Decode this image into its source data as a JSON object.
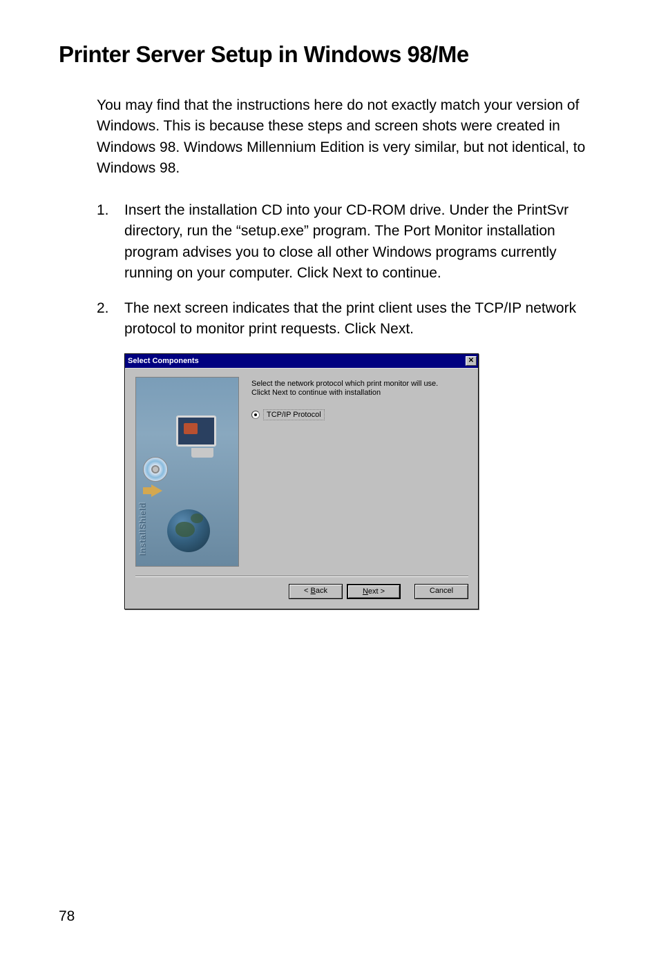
{
  "heading": "Printer Server Setup in Windows 98/Me",
  "intro": "You may find that the instructions here do not exactly match your version of Windows. This is because these steps and screen shots were created in Windows 98. Windows Millennium Edition is very similar, but not identical, to Windows 98.",
  "steps": [
    {
      "number": "1.",
      "text": "Insert the installation CD into your CD-ROM drive. Under the PrintSvr directory, run the “setup.exe” program. The Port Monitor installation program advises you to close all other Windows programs currently running on your computer. Click Next to continue."
    },
    {
      "number": "2.",
      "text": "The next screen indicates that the print client uses the TCP/IP network protocol to monitor print requests. Click Next."
    }
  ],
  "dialog": {
    "title": "Select Components",
    "close_glyph": "✕",
    "install_shield": "InstallShield",
    "instruction_line1": "Select the network protocol which print monitor will use.",
    "instruction_line2": "Clickt Next to continue with installation",
    "radio_option": "TCP/IP  Protocol",
    "buttons": {
      "back_prefix": "< ",
      "back_letter": "B",
      "back_suffix": "ack",
      "next_letter": "N",
      "next_suffix": "ext >",
      "cancel": "Cancel"
    }
  },
  "page_number": "78"
}
